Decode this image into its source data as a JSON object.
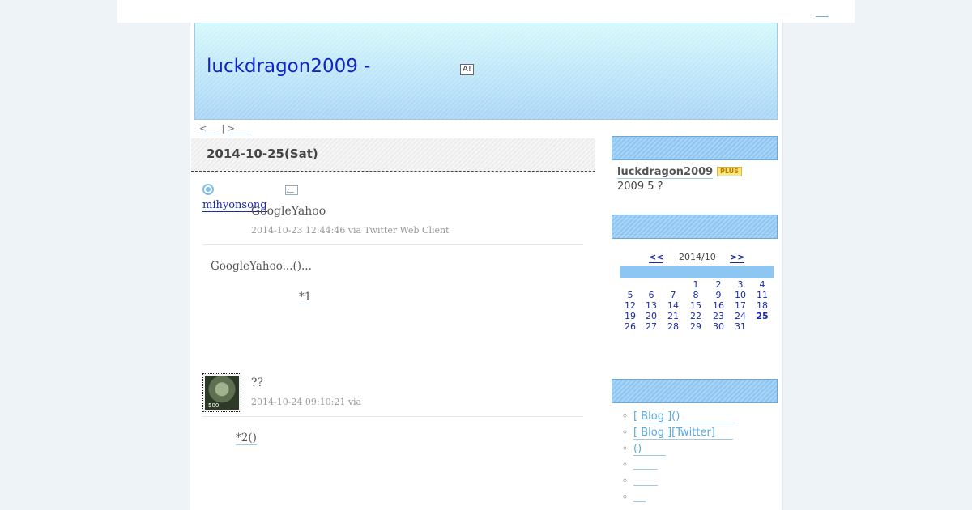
{
  "header": {
    "blog_title": "luckdragon2009 -",
    "ad_badge": "A!"
  },
  "nav": {
    "prev": "<",
    "separator": "|",
    "next": ">"
  },
  "entry": {
    "date": "2014-10-25(Sat)"
  },
  "tweets": [
    {
      "user": "mihyonsong",
      "title": "GoogleYahoo",
      "meta": "2014-10-23 12:44:46 via Twitter Web Client",
      "body": "GoogleYahoo...()...",
      "footnote": "*1"
    },
    {
      "title": "??",
      "meta": "2014-10-24 09:10:21 via",
      "footnote": "*2()",
      "stamp_value": "500"
    }
  ],
  "sidebar": {
    "profile": {
      "name": "luckdragon2009",
      "badge": "PLUS",
      "desc": "2009 5 ?"
    },
    "calendar": {
      "prev": "<<",
      "month": "2014/10",
      "next": ">>",
      "today": "25",
      "weeks": [
        [
          "",
          "",
          "",
          "1",
          "2",
          "3",
          "4"
        ],
        [
          "5",
          "6",
          "7",
          "8",
          "9",
          "10",
          "11"
        ],
        [
          "12",
          "13",
          "14",
          "15",
          "16",
          "17",
          "18"
        ],
        [
          "19",
          "20",
          "21",
          "22",
          "23",
          "24",
          "25"
        ],
        [
          "26",
          "27",
          "28",
          "29",
          "30",
          "31",
          ""
        ]
      ]
    },
    "links": [
      "[ Blog ]()",
      "[ Blog ][Twitter]",
      "()",
      "",
      "",
      ""
    ]
  },
  "colors": {
    "link": "#1a2aa8",
    "accent": "#8ec6f2",
    "header_top": "#d4f8fb",
    "header_bottom": "#a7d4f6"
  }
}
